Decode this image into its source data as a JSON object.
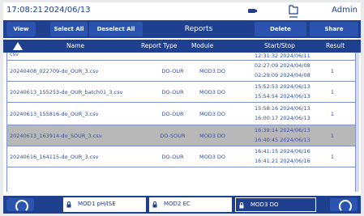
{
  "status": {
    "time": "17:08:21",
    "date": "2024/06/13",
    "user": "Admin"
  },
  "toolbar": {
    "view": "View",
    "select_all": "Select All",
    "deselect_all": "Deselect All",
    "title": "Reports",
    "delete": "Delete",
    "share": "Share"
  },
  "columns": {
    "name": "Name",
    "report_type": "Report Type",
    "module": "Module",
    "start_stop": "Start/Stop",
    "result": "Result"
  },
  "rows": [
    {
      "name": "csv",
      "type": "",
      "module": "",
      "start": "12:31:32 2024/06/11",
      "stop": "",
      "result": "",
      "selected": false
    },
    {
      "name": "20240408_022709-do_OUR_3.csv",
      "type": "DO-OUR",
      "module": "MOD3 DO",
      "start": "02:27:09 2024/04/08",
      "stop": "02:29:09 2024/04/08",
      "result": "1",
      "selected": false
    },
    {
      "name": "20240613_155253-do_OUR_batch01_3.csv",
      "type": "DO-OUR",
      "module": "MOD3 DO",
      "start": "15:52:53 2024/06/13",
      "stop": "15:54:54 2024/06/13",
      "result": "1",
      "selected": false
    },
    {
      "name": "20240613_155816-do_OUR_3.csv",
      "type": "DO-OUR",
      "module": "MOD3 DO",
      "start": "15:58:16 2024/06/13",
      "stop": "16:00:17 2024/06/13",
      "result": "1",
      "selected": false
    },
    {
      "name": "20240613_163914-do_SOUR_3.csv",
      "type": "DO-SOUR",
      "module": "MOD3 DO",
      "start": "16:39:14 2024/06/13",
      "stop": "16:40:45 2024/06/13",
      "result": "1",
      "selected": true
    },
    {
      "name": "20240616_164115-do_OUR_3.csv",
      "type": "DO-OUR",
      "module": "MOD3 DO",
      "start": "16:41:15 2024/06/16",
      "stop": "16:41:21 2024/06/16",
      "result": "1",
      "selected": false
    }
  ],
  "bottom": {
    "mod1": "MOD1 pH/ISE",
    "mod2": "MOD2 EC",
    "mod3": "MOD3 DO"
  },
  "colors": {
    "primary": "#1f3f8f",
    "button": "#2a54b0",
    "selected_row": "#b8b8b8"
  }
}
